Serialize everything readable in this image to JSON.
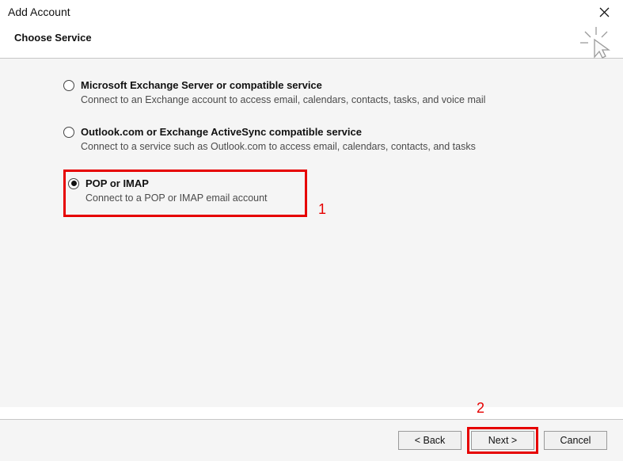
{
  "window": {
    "title": "Add Account"
  },
  "header": {
    "heading": "Choose Service"
  },
  "options": [
    {
      "title": "Microsoft Exchange Server or compatible service",
      "desc": "Connect to an Exchange account to access email, calendars, contacts, tasks, and voice mail",
      "selected": false
    },
    {
      "title": "Outlook.com or Exchange ActiveSync compatible service",
      "desc": "Connect to a service such as Outlook.com to access email, calendars, contacts, and tasks",
      "selected": false
    },
    {
      "title": "POP or IMAP",
      "desc": "Connect to a POP or IMAP email account",
      "selected": true
    }
  ],
  "annotations": {
    "opt_highlight": "1",
    "next_highlight": "2"
  },
  "footer": {
    "back": "< Back",
    "next": "Next >",
    "cancel": "Cancel"
  }
}
